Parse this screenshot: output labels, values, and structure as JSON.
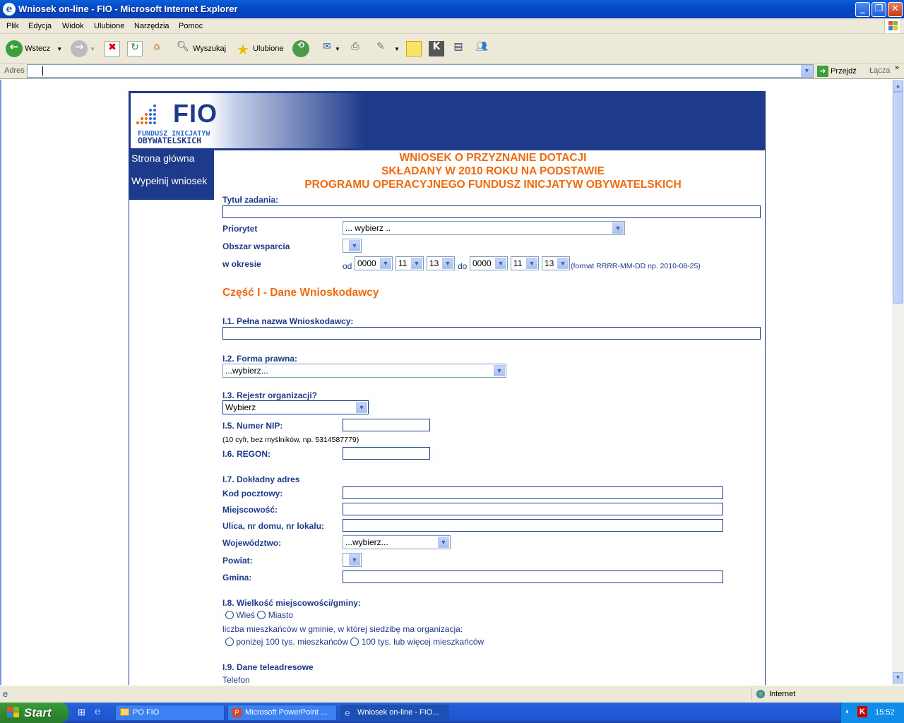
{
  "window": {
    "title": "Wniosek on-line - FIO - Microsoft Internet Explorer"
  },
  "menu": [
    "Plik",
    "Edycja",
    "Widok",
    "Ulubione",
    "Narzędzia",
    "Pomoc"
  ],
  "toolbar": {
    "back": "Wstecz",
    "search": "Wyszukaj",
    "favorites": "Ulubione"
  },
  "address": {
    "label": "Adres",
    "value": "",
    "go": "Przejdź",
    "links": "Łącza"
  },
  "banner": {
    "logo_text": "FIO",
    "logo_line1": "FUNDUSZ INICJATYW",
    "logo_line2": "OBYWATELSKICH"
  },
  "nav": [
    "Strona główna",
    "Wypełnij wniosek"
  ],
  "heading": [
    "WNIOSEK O PRZYZNANIE DOTACJI",
    "SKŁADANY W 2010 ROKU NA PODSTAWIE",
    "PROGRAMU OPERACYJNEGO FUNDUSZ INICJATYW OBYWATELSKICH"
  ],
  "form": {
    "title_label": "Tytuł zadania:",
    "priority_label": "Priorytet",
    "priority_value": "... wybierz ..",
    "area_label": "Obszar wsparcia",
    "period_label": "w okresie",
    "od": "od",
    "do": "do",
    "from_year": "0000",
    "from_month": "11",
    "from_day": "13",
    "to_year": "0000",
    "to_month": "11",
    "to_day": "13",
    "date_hint": "(format RRRR-MM-DD np. 2010-08-25)",
    "section1": "Część I - Dane Wnioskodawcy",
    "i1": "I.1. Pełna nazwa Wnioskodawcy:",
    "i2": "I.2. Forma prawna:",
    "i2_value": "...wybierz...",
    "i3": "I.3. Rejestr organizacji?",
    "i3_value": "Wybierz",
    "i5": "I.5. Numer NIP:",
    "i5_hint": "(10 cyfr, bez myślników, np. 5314587779)",
    "i6": "I.6. REGON:",
    "i7": "I.7. Dokładny adres",
    "postal": "Kod pocztowy:",
    "city": "Miejscowość:",
    "street": "Ulica, nr domu, nr lokalu:",
    "voivodeship": "Województwo:",
    "voivodeship_value": "...wybierz...",
    "district": "Powiat:",
    "commune": "Gmina:",
    "i8": "I.8. Wielkość miejscowości/gminy:",
    "village": "Wieś",
    "town": "Miasto",
    "population_q": "liczba mieszkańców w gminie, w której siedzibę ma organizacja:",
    "pop_small": "poniżej 100 tys. mieszkańców",
    "pop_large": "100 tys. lub więcej mieszkańców",
    "i9": "I.9. Dane teleadresowe",
    "phone": "Telefon"
  },
  "status": {
    "zone": "Internet"
  },
  "taskbar": {
    "start": "Start",
    "tasks": [
      "PO FIO",
      "Microsoft PowerPoint ...",
      "Wniosek on-line - FIO..."
    ],
    "clock": "15:52"
  },
  "colors": {
    "brand_blue": "#1e3a8a",
    "heading_orange": "#f06a10"
  }
}
